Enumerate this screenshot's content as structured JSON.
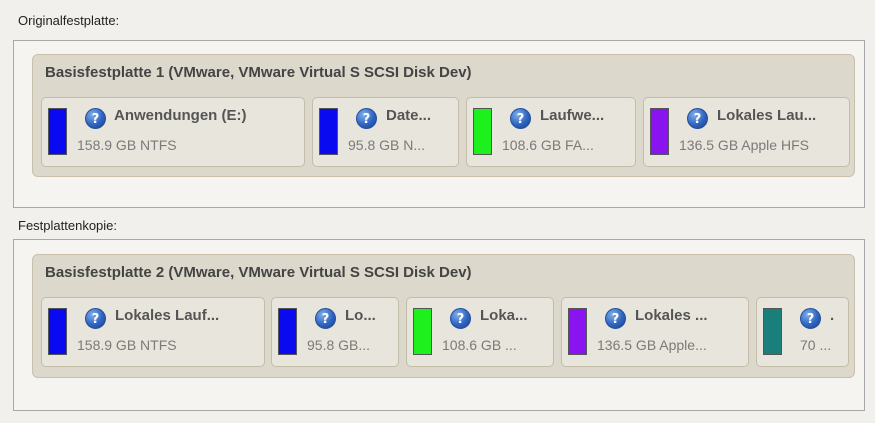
{
  "original": {
    "label": "Originalfestplatte:",
    "disk_title": "Basisfestplatte 1 (VMware, VMware Virtual S SCSI Disk Dev)",
    "partitions": [
      {
        "name": "Anwendungen (E:)",
        "info": "158.9 GB NTFS",
        "color": "#0a0af0"
      },
      {
        "name": "Date...",
        "info": "95.8 GB N...",
        "color": "#0a0af0"
      },
      {
        "name": "Laufwe...",
        "info": "108.6 GB FA...",
        "color": "#1ef01e"
      },
      {
        "name": "Lokales Lau...",
        "info": "136.5 GB Apple HFS",
        "color": "#8a14f0"
      }
    ]
  },
  "copy": {
    "label": "Festplattenkopie:",
    "disk_title": "Basisfestplatte 2 (VMware, VMware Virtual S SCSI Disk Dev)",
    "partitions": [
      {
        "name": "Lokales Lauf...",
        "info": "158.9 GB NTFS",
        "color": "#0a0af0"
      },
      {
        "name": "Lo...",
        "info": "95.8 GB...",
        "color": "#0a0af0"
      },
      {
        "name": "Loka...",
        "info": "108.6 GB ...",
        "color": "#1ef01e"
      },
      {
        "name": "Lokales ...",
        "info": "136.5 GB Apple...",
        "color": "#8a14f0"
      },
      {
        "name": ".",
        "info": "70 ...",
        "color": "#1a7e7a"
      }
    ]
  },
  "help_glyph": "?"
}
